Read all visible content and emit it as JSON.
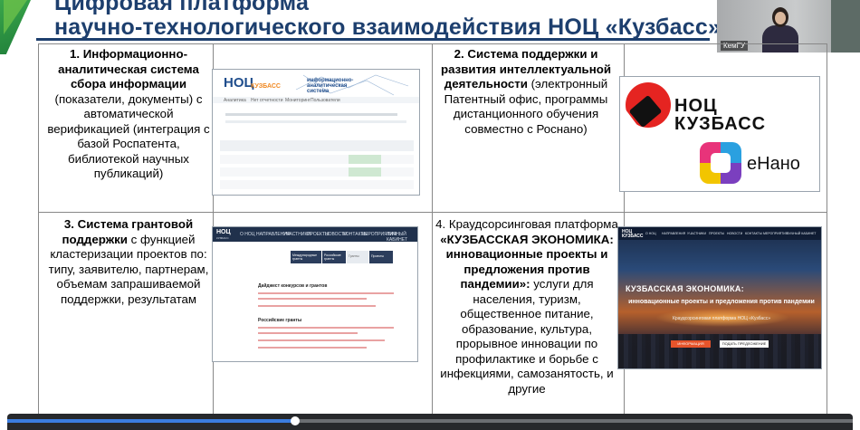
{
  "slide": {
    "title_line1": "Цифровая платформа",
    "title_line2": "научно-технологического взаимодействия НОЦ «Кузбасс»"
  },
  "video": {
    "label": "КемГУ"
  },
  "cells": [
    {
      "lead_bold": "1. Информационно-аналитическая система сбора информации",
      "body": " (показатели, документы) с автоматической верификацией (интеграция с базой Роспатента, библиотекой научных публикаций)"
    },
    {
      "lead_bold": "2. Система поддержки и развития интеллектуальной деятельности",
      "body": " (электронный Патентный офис, программы дистанционного обучения совместно с Роснано)"
    },
    {
      "lead_bold": "3. Система грантовой поддержки",
      "body": " с функцией кластеризации проектов по: типу, заявителю, партнерам, объемам запрашиваемой поддержки, результатам"
    },
    {
      "lead_plain": "4. Краудсорсинговая платформа ",
      "lead_bold": "«КУЗБАССКАЯ ЭКОНОМИКА: инновационные проекты и предложения против пандемии»:",
      "body": " услуги для населения, туризм, общественное питание, образование, культура, прорывное инновации по профилактике и борьбе с инфекциями, самозанятость, и другие"
    }
  ],
  "screenshot1": {
    "logo": "НОЦ",
    "logo_sub": "КУЗБАСС",
    "system_title": "информационно-аналитическая система",
    "nav": [
      "Аналитика",
      "Нет отчетности",
      "Мониторинг",
      "Пользователи"
    ]
  },
  "logos": {
    "noc_text_1": "НОЦ",
    "noc_text_2": "КУЗБАСС",
    "enano": "еНано"
  },
  "screenshot3": {
    "logo": "НОЦ",
    "logo_sub": "КУЗБАСС",
    "nav": [
      "О НОЦ",
      "НАПРАВЛЕНИЯ",
      "УЧАСТНИКИ",
      "ПРОЕКТЫ",
      "НОВОСТИ",
      "КОНТАКТЫ",
      "МЕРОПРИЯТИЯ",
      "ЛИЧНЫЙ КАБИНЕТ"
    ],
    "tabs": [
      "Международные гранты",
      "Российские гранты",
      "Гранты",
      "Проекты"
    ],
    "section1": "Дайджест конкурсов и грантов",
    "section2": "Российские гранты"
  },
  "hero": {
    "logo": "НОЦ КУЗБАСС",
    "nav": [
      "О НОЦ",
      "НАПРАВЛЕНИЯ",
      "УЧАСТНИКИ",
      "ПРОЕКТЫ",
      "НОВОСТИ",
      "КОНТАКТЫ",
      "МЕРОПРИЯТИЯ",
      "ЛИЧНЫЙ КАБИНЕТ"
    ],
    "headline": "КУЗБАССКАЯ ЭКОНОМИКА:",
    "subline": "инновационные проекты и предложения против пандемии",
    "caption": "Краудсорсинговая платформа НОЦ «Кузбасс»",
    "btn1": "ИНФОРМАЦИЯ",
    "btn2": "ПОДАТЬ ПРЕДЛОЖЕНИЕ"
  },
  "player": {
    "progress": 0.34
  },
  "colors": {
    "title": "#1d3f6e",
    "accent_red": "#e52421",
    "nav_dark": "#20314c"
  }
}
